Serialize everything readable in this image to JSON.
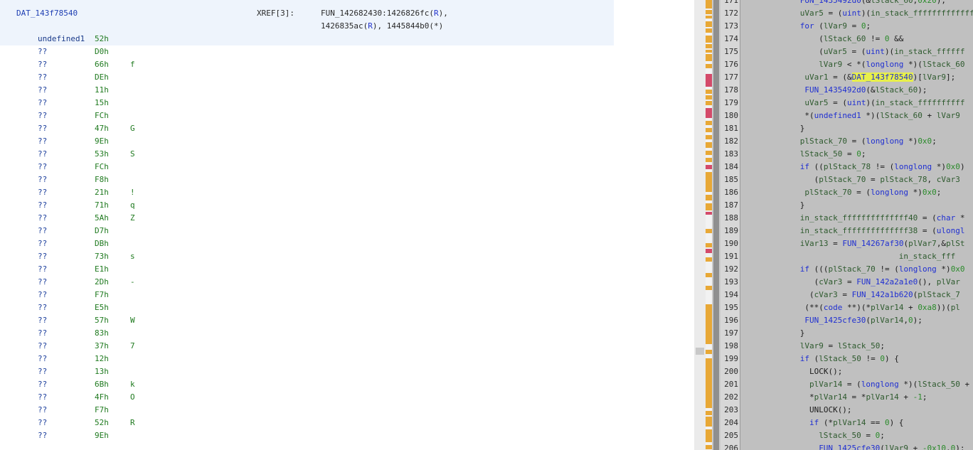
{
  "listing": {
    "header": {
      "label": "DAT_143f78540",
      "xref_title": "XREF[3]:",
      "xref_line1_fn": "FUN_142682430:1426826fc",
      "xref_line1_rw": "R",
      "xref_line2_a": "1426835ac",
      "xref_line2_a_rw": "R",
      "xref_line2_b": "1445844b0",
      "xref_line2_b_rw": "*",
      "first_type": "undefined1",
      "first_value": "52h"
    },
    "rows": [
      {
        "t": "??",
        "h": "D0h",
        "a": ""
      },
      {
        "t": "??",
        "h": "66h",
        "a": "f"
      },
      {
        "t": "??",
        "h": "DEh",
        "a": ""
      },
      {
        "t": "??",
        "h": "11h",
        "a": ""
      },
      {
        "t": "??",
        "h": "15h",
        "a": ""
      },
      {
        "t": "??",
        "h": "FCh",
        "a": ""
      },
      {
        "t": "??",
        "h": "47h",
        "a": "G"
      },
      {
        "t": "??",
        "h": "9Eh",
        "a": ""
      },
      {
        "t": "??",
        "h": "53h",
        "a": "S"
      },
      {
        "t": "??",
        "h": "FCh",
        "a": ""
      },
      {
        "t": "??",
        "h": "F8h",
        "a": ""
      },
      {
        "t": "??",
        "h": "21h",
        "a": "!"
      },
      {
        "t": "??",
        "h": "71h",
        "a": "q"
      },
      {
        "t": "??",
        "h": "5Ah",
        "a": "Z"
      },
      {
        "t": "??",
        "h": "D7h",
        "a": ""
      },
      {
        "t": "??",
        "h": "DBh",
        "a": ""
      },
      {
        "t": "??",
        "h": "73h",
        "a": "s"
      },
      {
        "t": "??",
        "h": "E1h",
        "a": ""
      },
      {
        "t": "??",
        "h": "2Dh",
        "a": "-"
      },
      {
        "t": "??",
        "h": "F7h",
        "a": ""
      },
      {
        "t": "??",
        "h": "E5h",
        "a": ""
      },
      {
        "t": "??",
        "h": "57h",
        "a": "W"
      },
      {
        "t": "??",
        "h": "83h",
        "a": ""
      },
      {
        "t": "??",
        "h": "37h",
        "a": "7"
      },
      {
        "t": "??",
        "h": "12h",
        "a": ""
      },
      {
        "t": "??",
        "h": "13h",
        "a": ""
      },
      {
        "t": "??",
        "h": "6Bh",
        "a": "k"
      },
      {
        "t": "??",
        "h": "4Fh",
        "a": "O"
      },
      {
        "t": "??",
        "h": "F7h",
        "a": ""
      },
      {
        "t": "??",
        "h": "52h",
        "a": "R"
      },
      {
        "t": "??",
        "h": "9Eh",
        "a": ""
      }
    ]
  },
  "decompiler": {
    "lines": [
      {
        "n": "171",
        "i": 6,
        "s": [
          [
            "fn",
            "FUN_1435492d0"
          ],
          [
            "plain",
            "(&"
          ],
          [
            "var",
            "lStack_60"
          ],
          [
            "plain",
            ","
          ],
          [
            "num",
            "0x20"
          ],
          [
            "plain",
            ");"
          ]
        ]
      },
      {
        "n": "172",
        "i": 6,
        "s": [
          [
            "var",
            "uVar5"
          ],
          [
            "plain",
            " = ("
          ],
          [
            "ty",
            "uint"
          ],
          [
            "plain",
            ")("
          ],
          [
            "var",
            "in_stack_ffffffffffffff"
          ]
        ]
      },
      {
        "n": "173",
        "i": 6,
        "s": [
          [
            "kw",
            "for"
          ],
          [
            "plain",
            " ("
          ],
          [
            "var",
            "lVar9"
          ],
          [
            "plain",
            " = "
          ],
          [
            "num",
            "0"
          ],
          [
            "plain",
            ";"
          ]
        ]
      },
      {
        "n": "174",
        "i": 10,
        "s": [
          [
            "plain",
            "("
          ],
          [
            "var",
            "lStack_60"
          ],
          [
            "plain",
            " != "
          ],
          [
            "num",
            "0"
          ],
          [
            "plain",
            " &&"
          ]
        ]
      },
      {
        "n": "175",
        "i": 10,
        "s": [
          [
            "plain",
            "("
          ],
          [
            "var",
            "uVar5"
          ],
          [
            "plain",
            " = ("
          ],
          [
            "ty",
            "uint"
          ],
          [
            "plain",
            ")("
          ],
          [
            "var",
            "in_stack_ffffff"
          ]
        ]
      },
      {
        "n": "176",
        "i": 10,
        "s": [
          [
            "var",
            "lVar9"
          ],
          [
            "plain",
            " < *("
          ],
          [
            "ty",
            "longlong"
          ],
          [
            "plain",
            " *)("
          ],
          [
            "var",
            "lStack_60"
          ]
        ]
      },
      {
        "n": "177",
        "i": 7,
        "s": [
          [
            "var",
            "uVar1"
          ],
          [
            "plain",
            " = (&"
          ],
          [
            "hl",
            "DAT_143f78540"
          ],
          [
            "plain",
            ")["
          ],
          [
            "var",
            "lVar9"
          ],
          [
            "plain",
            "];"
          ]
        ]
      },
      {
        "n": "178",
        "i": 7,
        "s": [
          [
            "fn",
            "FUN_1435492d0"
          ],
          [
            "plain",
            "(&"
          ],
          [
            "var",
            "lStack_60"
          ],
          [
            "plain",
            ");"
          ]
        ]
      },
      {
        "n": "179",
        "i": 7,
        "s": [
          [
            "var",
            "uVar5"
          ],
          [
            "plain",
            " = ("
          ],
          [
            "ty",
            "uint"
          ],
          [
            "plain",
            ")("
          ],
          [
            "var",
            "in_stack_ffffffffff"
          ]
        ]
      },
      {
        "n": "180",
        "i": 7,
        "s": [
          [
            "plain",
            "*("
          ],
          [
            "ty",
            "undefined1"
          ],
          [
            "plain",
            " *)("
          ],
          [
            "var",
            "lStack_60"
          ],
          [
            "plain",
            " + "
          ],
          [
            "var",
            "lVar9"
          ]
        ]
      },
      {
        "n": "181",
        "i": 6,
        "s": [
          [
            "plain",
            "}"
          ]
        ]
      },
      {
        "n": "182",
        "i": 6,
        "s": [
          [
            "var",
            "plStack_70"
          ],
          [
            "plain",
            " = ("
          ],
          [
            "ty",
            "longlong"
          ],
          [
            "plain",
            " *)"
          ],
          [
            "num",
            "0x0"
          ],
          [
            "plain",
            ";"
          ]
        ]
      },
      {
        "n": "183",
        "i": 6,
        "s": [
          [
            "var",
            "lStack_50"
          ],
          [
            "plain",
            " = "
          ],
          [
            "num",
            "0"
          ],
          [
            "plain",
            ";"
          ]
        ]
      },
      {
        "n": "184",
        "i": 6,
        "s": [
          [
            "kw",
            "if"
          ],
          [
            "plain",
            " (("
          ],
          [
            "var",
            "plStack_78"
          ],
          [
            "plain",
            " != ("
          ],
          [
            "ty",
            "longlong"
          ],
          [
            "plain",
            " *)"
          ],
          [
            "num",
            "0x0"
          ],
          [
            "plain",
            ")"
          ]
        ]
      },
      {
        "n": "185",
        "i": 9,
        "s": [
          [
            "plain",
            "("
          ],
          [
            "var",
            "plStack_70"
          ],
          [
            "plain",
            " = "
          ],
          [
            "var",
            "plStack_78"
          ],
          [
            "plain",
            ", "
          ],
          [
            "var",
            "cVar3"
          ]
        ]
      },
      {
        "n": "186",
        "i": 7,
        "s": [
          [
            "var",
            "plStack_70"
          ],
          [
            "plain",
            " = ("
          ],
          [
            "ty",
            "longlong"
          ],
          [
            "plain",
            " *)"
          ],
          [
            "num",
            "0x0"
          ],
          [
            "plain",
            ";"
          ]
        ]
      },
      {
        "n": "187",
        "i": 6,
        "s": [
          [
            "plain",
            "}"
          ]
        ]
      },
      {
        "n": "188",
        "i": 6,
        "s": [
          [
            "var",
            "in_stack_ffffffffffffff40"
          ],
          [
            "plain",
            " = ("
          ],
          [
            "ty",
            "char"
          ],
          [
            "plain",
            " *"
          ]
        ]
      },
      {
        "n": "189",
        "i": 6,
        "s": [
          [
            "var",
            "in_stack_ffffffffffffff38"
          ],
          [
            "plain",
            " = ("
          ],
          [
            "ty",
            "ulongl"
          ]
        ]
      },
      {
        "n": "190",
        "i": 6,
        "s": [
          [
            "var",
            "iVar13"
          ],
          [
            "plain",
            " = "
          ],
          [
            "fn",
            "FUN_14267af30"
          ],
          [
            "plain",
            "("
          ],
          [
            "var",
            "plVar7"
          ],
          [
            "plain",
            ",&"
          ],
          [
            "var",
            "plSt"
          ]
        ]
      },
      {
        "n": "191",
        "i": 27,
        "s": [
          [
            "var",
            "in_stack_fff"
          ]
        ]
      },
      {
        "n": "192",
        "i": 6,
        "s": [
          [
            "kw",
            "if"
          ],
          [
            "plain",
            " ((("
          ],
          [
            "var",
            "plStack_70"
          ],
          [
            "plain",
            " != ("
          ],
          [
            "ty",
            "longlong"
          ],
          [
            "plain",
            " *)"
          ],
          [
            "num",
            "0x0"
          ]
        ]
      },
      {
        "n": "193",
        "i": 9,
        "s": [
          [
            "plain",
            "("
          ],
          [
            "var",
            "cVar3"
          ],
          [
            "plain",
            " = "
          ],
          [
            "fn",
            "FUN_142a2a1e0"
          ],
          [
            "plain",
            "(), "
          ],
          [
            "var",
            "plVar"
          ]
        ]
      },
      {
        "n": "194",
        "i": 8,
        "s": [
          [
            "plain",
            "("
          ],
          [
            "var",
            "cVar3"
          ],
          [
            "plain",
            " = "
          ],
          [
            "fn",
            "FUN_142a1b620"
          ],
          [
            "plain",
            "("
          ],
          [
            "var",
            "plStack_7"
          ]
        ]
      },
      {
        "n": "195",
        "i": 7,
        "s": [
          [
            "plain",
            "(**("
          ],
          [
            "ty",
            "code"
          ],
          [
            "plain",
            " **)(*"
          ],
          [
            "var",
            "plVar14"
          ],
          [
            "plain",
            " + "
          ],
          [
            "num",
            "0xa8"
          ],
          [
            "plain",
            "))("
          ],
          [
            "var",
            "pl"
          ]
        ]
      },
      {
        "n": "196",
        "i": 7,
        "s": [
          [
            "fn",
            "FUN_1425cfe30"
          ],
          [
            "plain",
            "("
          ],
          [
            "var",
            "plVar14"
          ],
          [
            "plain",
            ","
          ],
          [
            "num",
            "0"
          ],
          [
            "plain",
            ");"
          ]
        ]
      },
      {
        "n": "197",
        "i": 6,
        "s": [
          [
            "plain",
            "}"
          ]
        ]
      },
      {
        "n": "198",
        "i": 6,
        "s": [
          [
            "var",
            "lVar9"
          ],
          [
            "plain",
            " = "
          ],
          [
            "var",
            "lStack_50"
          ],
          [
            "plain",
            ";"
          ]
        ]
      },
      {
        "n": "199",
        "i": 6,
        "s": [
          [
            "kw",
            "if"
          ],
          [
            "plain",
            " ("
          ],
          [
            "var",
            "lStack_50"
          ],
          [
            "plain",
            " != "
          ],
          [
            "num",
            "0"
          ],
          [
            "plain",
            ") {"
          ]
        ]
      },
      {
        "n": "200",
        "i": 8,
        "s": [
          [
            "plain",
            "LOCK();"
          ]
        ]
      },
      {
        "n": "201",
        "i": 8,
        "s": [
          [
            "var",
            "plVar14"
          ],
          [
            "plain",
            " = ("
          ],
          [
            "ty",
            "longlong"
          ],
          [
            "plain",
            " *)("
          ],
          [
            "var",
            "lStack_50"
          ],
          [
            "plain",
            " +"
          ]
        ]
      },
      {
        "n": "202",
        "i": 8,
        "s": [
          [
            "plain",
            "*"
          ],
          [
            "var",
            "plVar14"
          ],
          [
            "plain",
            " = *"
          ],
          [
            "var",
            "plVar14"
          ],
          [
            "plain",
            " + "
          ],
          [
            "num",
            "-1"
          ],
          [
            "plain",
            ";"
          ]
        ]
      },
      {
        "n": "203",
        "i": 8,
        "s": [
          [
            "plain",
            "UNLOCK();"
          ]
        ]
      },
      {
        "n": "204",
        "i": 8,
        "s": [
          [
            "kw",
            "if"
          ],
          [
            "plain",
            " (*"
          ],
          [
            "var",
            "plVar14"
          ],
          [
            "plain",
            " == "
          ],
          [
            "num",
            "0"
          ],
          [
            "plain",
            ") {"
          ]
        ]
      },
      {
        "n": "205",
        "i": 10,
        "s": [
          [
            "var",
            "lStack_50"
          ],
          [
            "plain",
            " = "
          ],
          [
            "num",
            "0"
          ],
          [
            "plain",
            ";"
          ]
        ]
      },
      {
        "n": "206",
        "i": 10,
        "s": [
          [
            "fn",
            "FUN_1425cfe30"
          ],
          [
            "plain",
            "("
          ],
          [
            "var",
            "lVar9"
          ],
          [
            "plain",
            " + "
          ],
          [
            "num",
            "-0x10"
          ],
          [
            "plain",
            ","
          ],
          [
            "num",
            "0"
          ],
          [
            "plain",
            ");"
          ]
        ]
      }
    ]
  }
}
